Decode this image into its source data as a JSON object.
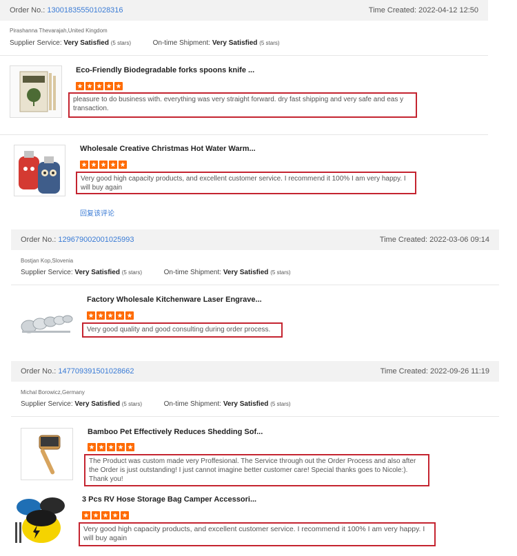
{
  "labels": {
    "order_no": "Order No.:",
    "time_created": "Time Created:",
    "supplier_service": "Supplier Service:",
    "ontime_shipment": "On-time Shipment:",
    "very_satisfied": "Very Satisfied",
    "five_stars": "(5 stars)"
  },
  "orders": [
    {
      "order_no": "130018355501028316",
      "time": "2022-04-12 12:50",
      "buyer": "Pirashanna Thevarajah,United Kingdom",
      "items": [
        {
          "title": "Eco-Friendly Biodegradable forks spoons knife ...",
          "stars": 5,
          "review": "pleasure to do business with. everything was very straight forward.  dry fast shipping and very safe and eas y transaction."
        },
        {
          "title": "Wholesale Creative Christmas Hot Water Warm...",
          "stars": 5,
          "review": "Very good high capacity products, and excellent customer service. I recommend it 100% I am very happy. I will buy again",
          "reply": "回复该评论"
        }
      ]
    },
    {
      "order_no": "129679002001025993",
      "time": "2022-03-06 09:14",
      "buyer": "Bostjan Kop,Slovenia",
      "items": [
        {
          "title": "Factory Wholesale Kitchenware Laser Engrave...",
          "stars": 5,
          "review": "Very good quality and good consulting during order process."
        }
      ]
    },
    {
      "order_no": "147709391501028662",
      "time": "2022-09-26 11:19",
      "buyer": "Michal Borowicz,Germany",
      "items": [
        {
          "title": "Bamboo Pet Effectively Reduces Shedding Sof...",
          "stars": 5,
          "review": "The Product was custom made very Proffesional. The Service through out the Order Process and also after the Order is just outstanding! I just cannot imagine better customer care! Special thanks goes to Nicole:). Thank you!"
        },
        {
          "title": "3 Pcs RV Hose Storage Bag Camper Accessori...",
          "stars": 5,
          "review": "Very good high capacity products, and excellent customer service. I recommend it 100% I am very happy. I will buy again"
        }
      ]
    }
  ],
  "colors": {
    "accent_link": "#3a7bd5",
    "star": "#ff6a00",
    "highlight_box": "#c4232f"
  }
}
